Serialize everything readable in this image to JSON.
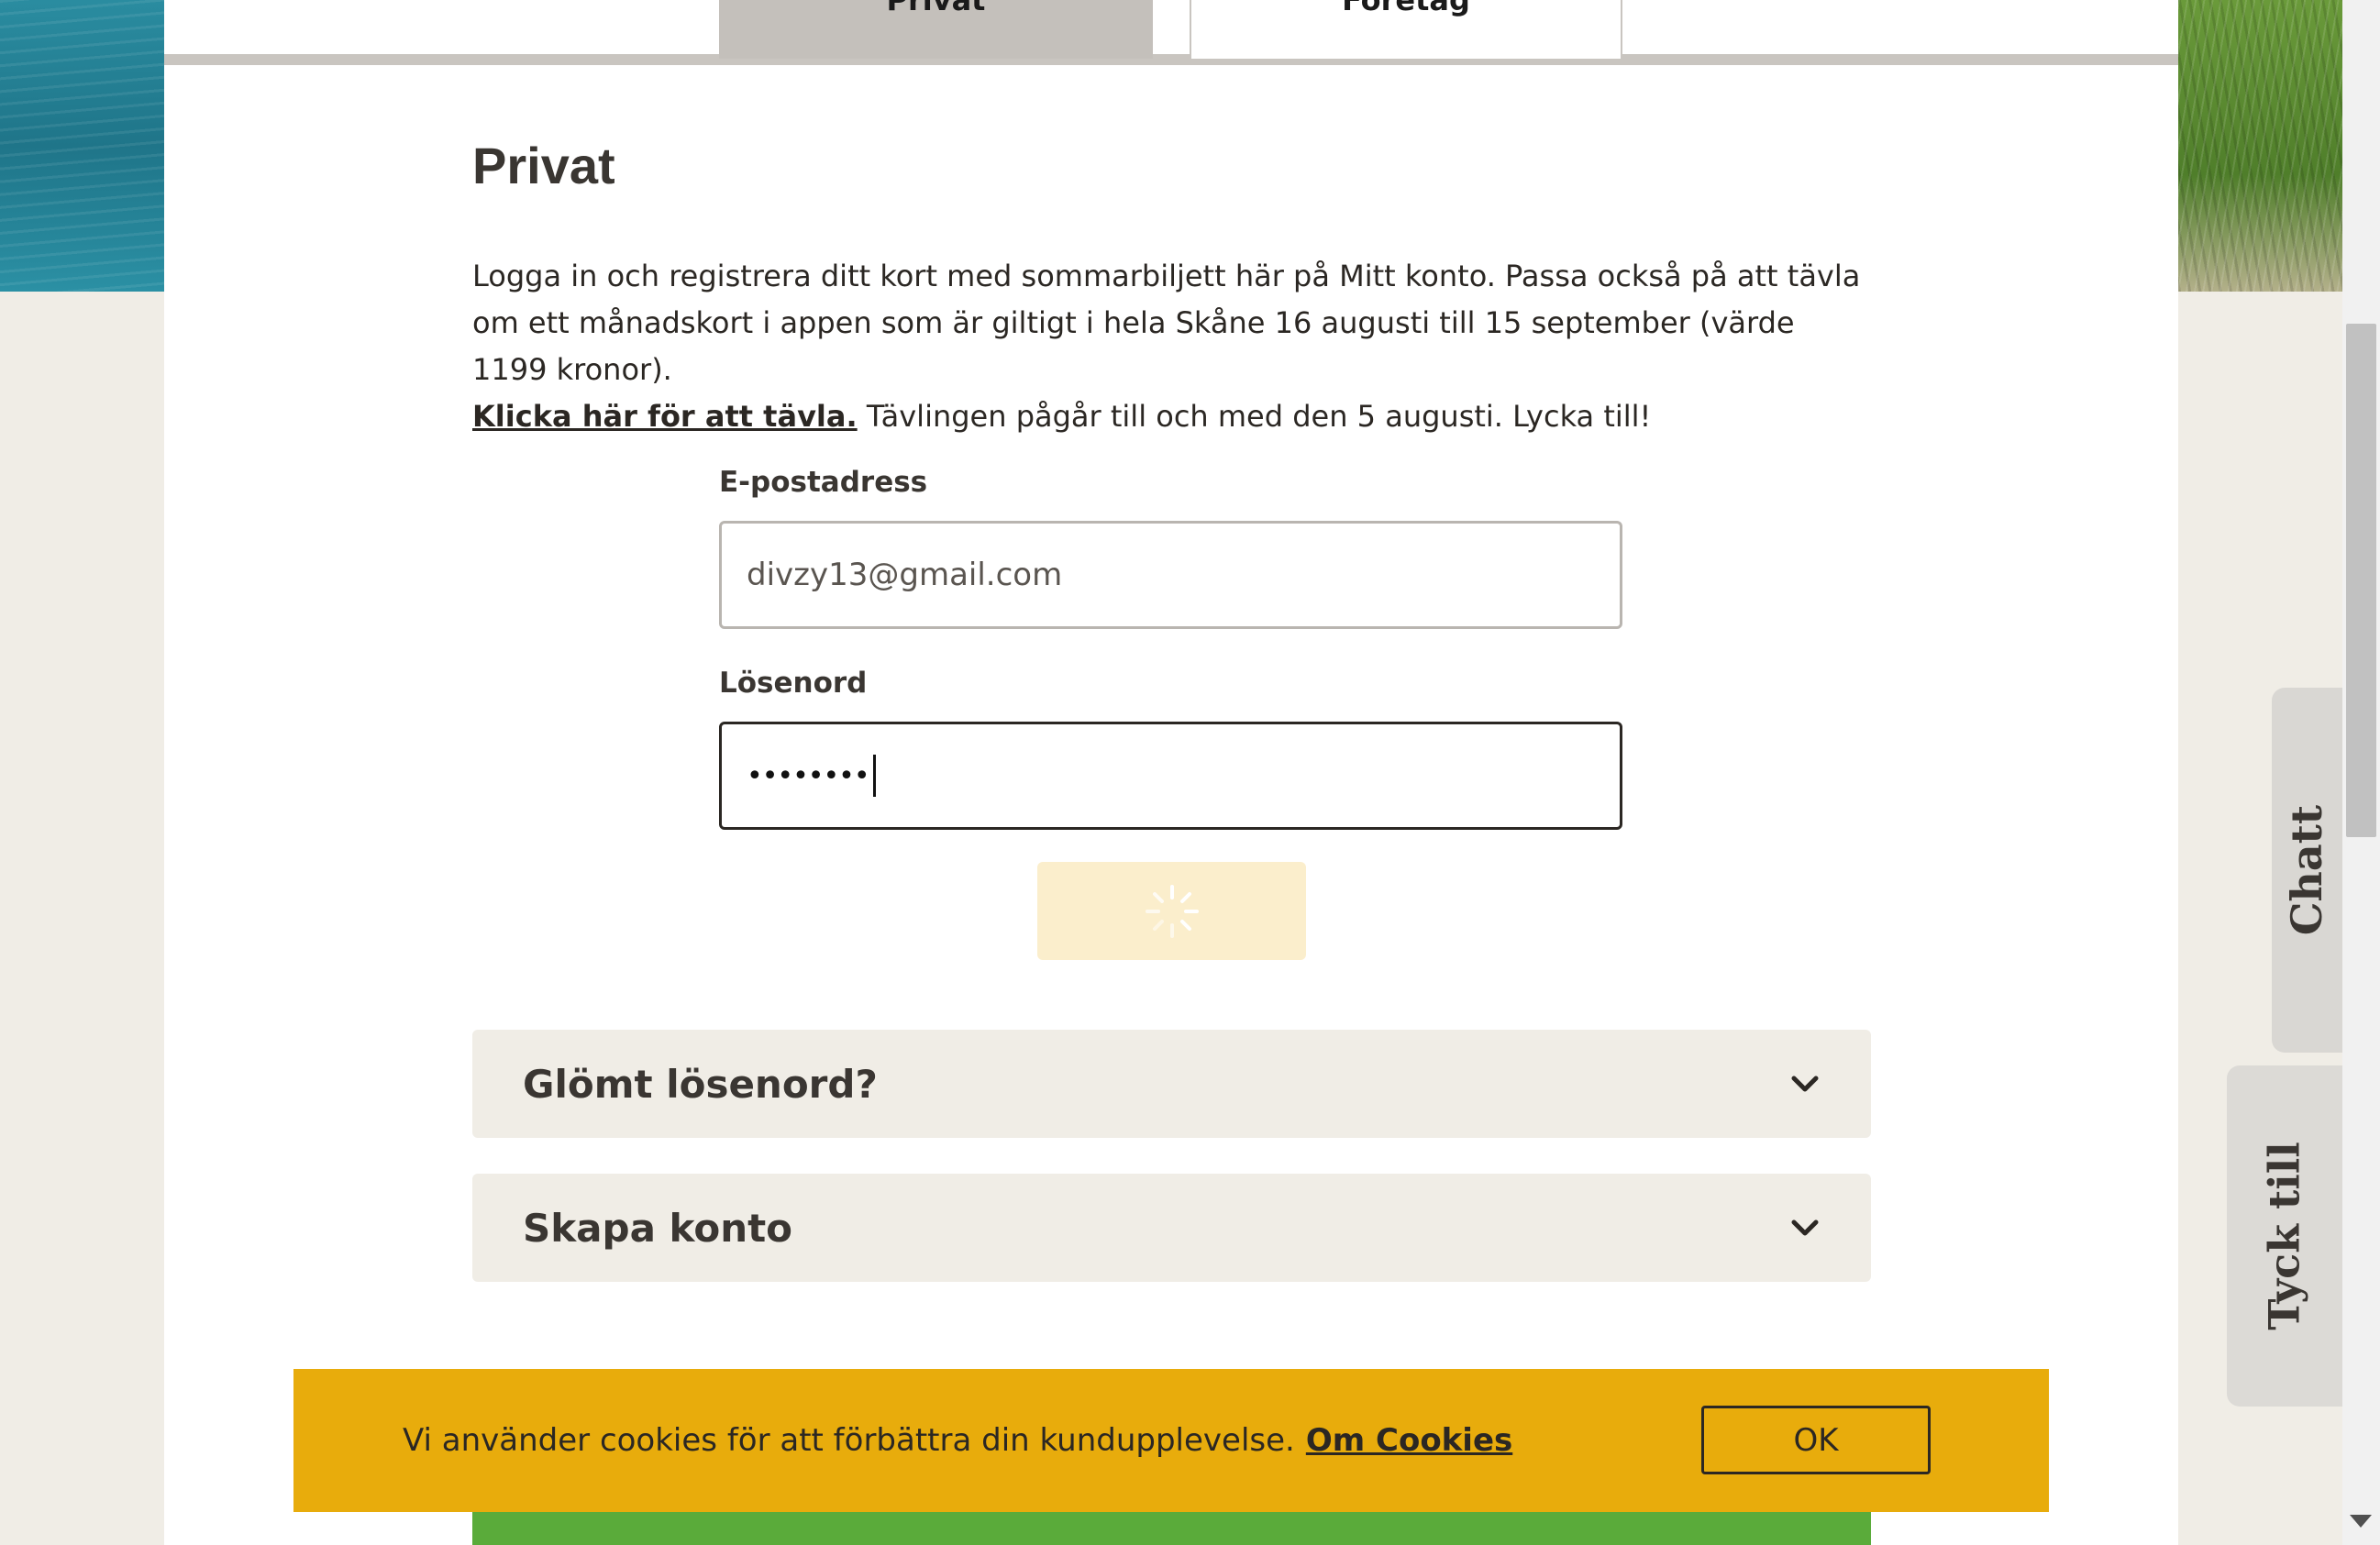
{
  "tabs": {
    "privat": "Privat",
    "foretag": "Företag"
  },
  "main": {
    "heading": "Privat",
    "intro_text": "Logga in och registrera ditt kort med sommarbiljett här på Mitt konto. Passa också på att tävla om ett månadskort i appen som är giltigt i hela Skåne 16 augusti till 15 september (värde 1199 kronor).",
    "intro_link": "Klicka här för att tävla.",
    "intro_tail": " Tävlingen pågår till och med den 5 augusti. Lycka till!"
  },
  "form": {
    "email_label": "E-postadress",
    "email_value": "divzy13@gmail.com",
    "password_label": "Lösenord",
    "password_value": "••••••••"
  },
  "accordions": {
    "forgot": "Glömt lösenord?",
    "create": "Skapa konto"
  },
  "cookie": {
    "text": "Vi använder cookies för att förbättra din kundupplevelse.",
    "link": "Om Cookies",
    "ok": "OK"
  },
  "side_tabs": {
    "chat": "Chatt",
    "feedback": "Tyck till"
  },
  "colors": {
    "cookie_bg": "#e8ac0c",
    "submit_loading_bg": "#fbeecc",
    "accordion_bg": "#f0ede6",
    "tab_active_bg": "#c4c0bb",
    "green_banner": "#5aab3a"
  },
  "icons": {
    "accordion": "chevron-down-icon",
    "submit": "loading-spinner-icon"
  }
}
